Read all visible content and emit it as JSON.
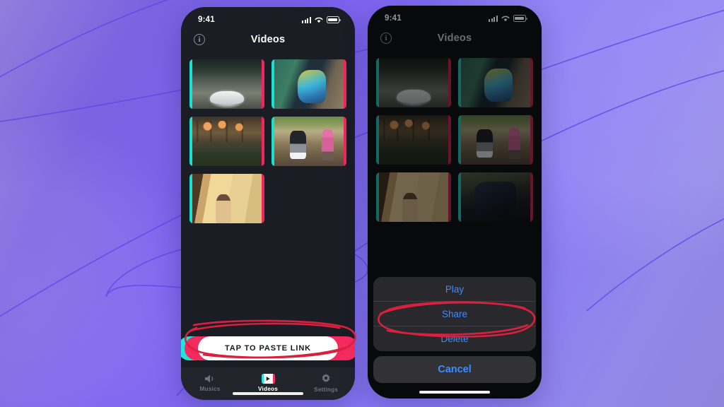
{
  "background": {
    "gradient_from": "#7a63e0",
    "gradient_to": "#9188e9",
    "accent_line": "#5b42e8"
  },
  "phones": [
    {
      "id": "phone-list",
      "status_bar": {
        "time": "9:41",
        "signal_icon": "cellular-bars-icon",
        "wifi_icon": "wifi-icon",
        "battery_icon": "battery-icon"
      },
      "nav": {
        "title": "Videos",
        "info_icon": "info-circle-icon",
        "info_glyph": "i"
      },
      "thumbnails": [
        {
          "name": "white-sports-car-tunnel",
          "scene": "sc-car",
          "selected": true
        },
        {
          "name": "police-arrest-colorful-shirt",
          "scene": "sc-cops",
          "selected": false
        },
        {
          "name": "house-with-hanging-lamps",
          "scene": "sc-house",
          "selected": false
        },
        {
          "name": "couple-in-park",
          "scene": "sc-park",
          "selected": false
        },
        {
          "name": "woman-on-staircase",
          "scene": "sc-stairs",
          "selected": false
        }
      ],
      "paste_button": {
        "label": "TAP TO PASTE LINK",
        "fill": "#ffffff",
        "glitch_cyan": "#22e3dc",
        "glitch_red": "#f4295d"
      },
      "tabs": [
        {
          "label": "Musics",
          "icon": "speaker-icon",
          "active": false
        },
        {
          "label": "Videos",
          "icon": "video-play-icon",
          "active": true
        },
        {
          "label": "Settings",
          "icon": "gear-icon",
          "active": false
        }
      ]
    },
    {
      "id": "phone-action-sheet",
      "status_bar": {
        "time": "9:41",
        "signal_icon": "cellular-bars-icon",
        "wifi_icon": "wifi-icon",
        "battery_icon": "battery-icon"
      },
      "nav": {
        "title": "Videos",
        "info_icon": "info-circle-icon",
        "info_glyph": "i"
      },
      "thumbnails": [
        {
          "name": "white-sports-car-tunnel",
          "scene": "sc-car",
          "selected": false
        },
        {
          "name": "police-arrest-colorful-shirt",
          "scene": "sc-cops",
          "selected": false
        },
        {
          "name": "house-with-hanging-lamps",
          "scene": "sc-house",
          "selected": false
        },
        {
          "name": "couple-in-park",
          "scene": "sc-park",
          "selected": false
        },
        {
          "name": "woman-on-staircase",
          "scene": "sc-stairs",
          "selected": false
        },
        {
          "name": "motorcycle-rider",
          "scene": "sc-moto",
          "selected": false
        }
      ],
      "action_sheet": {
        "items": [
          {
            "label": "Play",
            "name": "play"
          },
          {
            "label": "Share",
            "name": "share"
          },
          {
            "label": "Delete",
            "name": "delete"
          }
        ],
        "cancel_label": "Cancel",
        "tint": "#3e8bff"
      }
    }
  ],
  "annotations": [
    {
      "name": "paste-button-highlight",
      "shape": "hand-drawn-ellipse",
      "color": "#d8203f",
      "target": "TAP TO PASTE LINK"
    },
    {
      "name": "share-option-highlight",
      "shape": "hand-drawn-ellipse",
      "color": "#d8203f",
      "target": "Share"
    }
  ]
}
